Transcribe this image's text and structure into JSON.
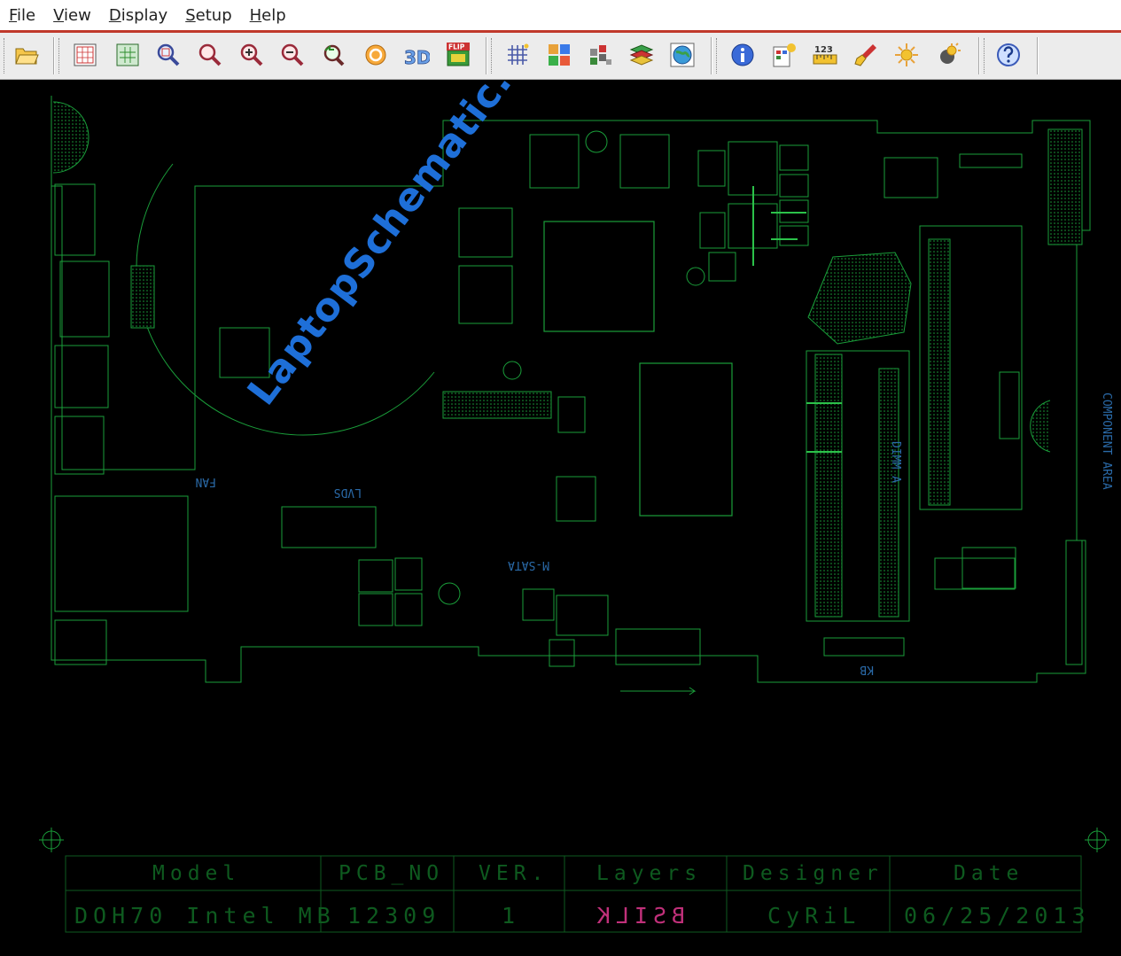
{
  "menu": [
    {
      "key": "F",
      "rest": "ile"
    },
    {
      "key": "V",
      "rest": "iew"
    },
    {
      "key": "D",
      "rest": "isplay"
    },
    {
      "key": "S",
      "rest": "etup"
    },
    {
      "key": "H",
      "rest": "elp"
    }
  ],
  "toolbar": {
    "three_d_label": "3D",
    "flip_label": "FLIP",
    "numbers_label": "123"
  },
  "board": {
    "labels": {
      "fan": "FAN",
      "lvds": "LVDS",
      "msata": "M-SATA",
      "dimm_a": "DIMM A",
      "component_area": "COMPONENT AREA",
      "kb": "KB"
    }
  },
  "title_block": {
    "headers": [
      "Model",
      "PCB_NO",
      "VER.",
      "Layers",
      "Designer",
      "Date"
    ],
    "values": [
      "DOH70 Intel MB",
      "12309",
      "1",
      "BSILK",
      "CyRiL",
      "06/25/2013"
    ]
  },
  "watermark": "LaptopSchematic.com",
  "colors": {
    "background": "#000000",
    "trace": "#1a9e3a",
    "highlight": "#2cc24a",
    "label_blue": "#2a6aa8",
    "watermark": "#1e6fd8",
    "layers_value": "#c0307a",
    "menu_underline": "#c0392b"
  }
}
